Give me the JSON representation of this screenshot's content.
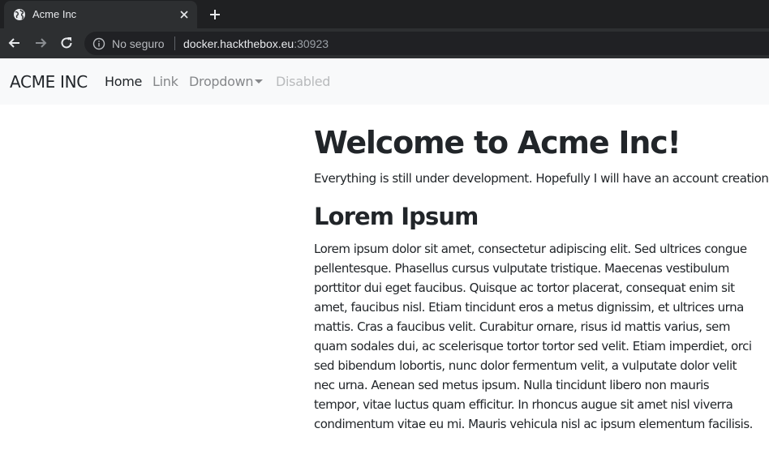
{
  "browser": {
    "tab_title": "Acme Inc",
    "security_label": "No seguro",
    "url_host": "docker.hackthebox.eu",
    "url_port": ":30923"
  },
  "navbar": {
    "brand": "ACME INC",
    "links": [
      {
        "label": "Home",
        "state": "active"
      },
      {
        "label": "Link",
        "state": "normal"
      },
      {
        "label": "Dropdown",
        "state": "dropdown"
      },
      {
        "label": "Disabled",
        "state": "disabled"
      }
    ]
  },
  "main": {
    "heading": "Welcome to Acme Inc!",
    "intro": "Everything is still under development. Hopefully I will have an account creation a",
    "subheading": "Lorem Ipsum",
    "paragraph": "Lorem ipsum dolor sit amet, consectetur adipiscing elit. Sed ultrices congue pellentesque. Phasellus cursus vulputate tristique. Maecenas vestibulum porttitor dui eget faucibus. Quisque ac tortor placerat, consequat enim sit amet, faucibus nisl. Etiam tincidunt eros a metus dignissim, et ultrices urna mattis. Cras a faucibus velit. Curabitur ornare, risus id mattis varius, sem quam sodales dui, ac scelerisque tortor tortor sed velit. Etiam imperdiet, orci sed bibendum lobortis, nunc dolor fermentum velit, a vulputate dolor velit nec urna. Aenean sed metus ipsum. Nulla tincidunt libero non mauris tempor, vitae luctus quam efficitur. In rhoncus augue sit amet nisl viverra condimentum vitae eu mi. Mauris vehicula nisl ac ipsum elementum facilisis."
  },
  "icons": {
    "tab_favicon": "globe-icon",
    "tab_close": "close-icon",
    "new_tab": "plus-icon",
    "back": "arrow-left-icon",
    "forward": "arrow-right-icon",
    "reload": "reload-icon",
    "site_info": "info-icon",
    "dropdown": "caret-down-icon"
  },
  "colors": {
    "chrome_dark": "#1f2022",
    "chrome_toolbar": "#2d2f31",
    "navbar_bg": "#f8f9fa",
    "text_primary": "#212529",
    "text_muted": "#85878a",
    "text_disabled": "#b8babc"
  }
}
